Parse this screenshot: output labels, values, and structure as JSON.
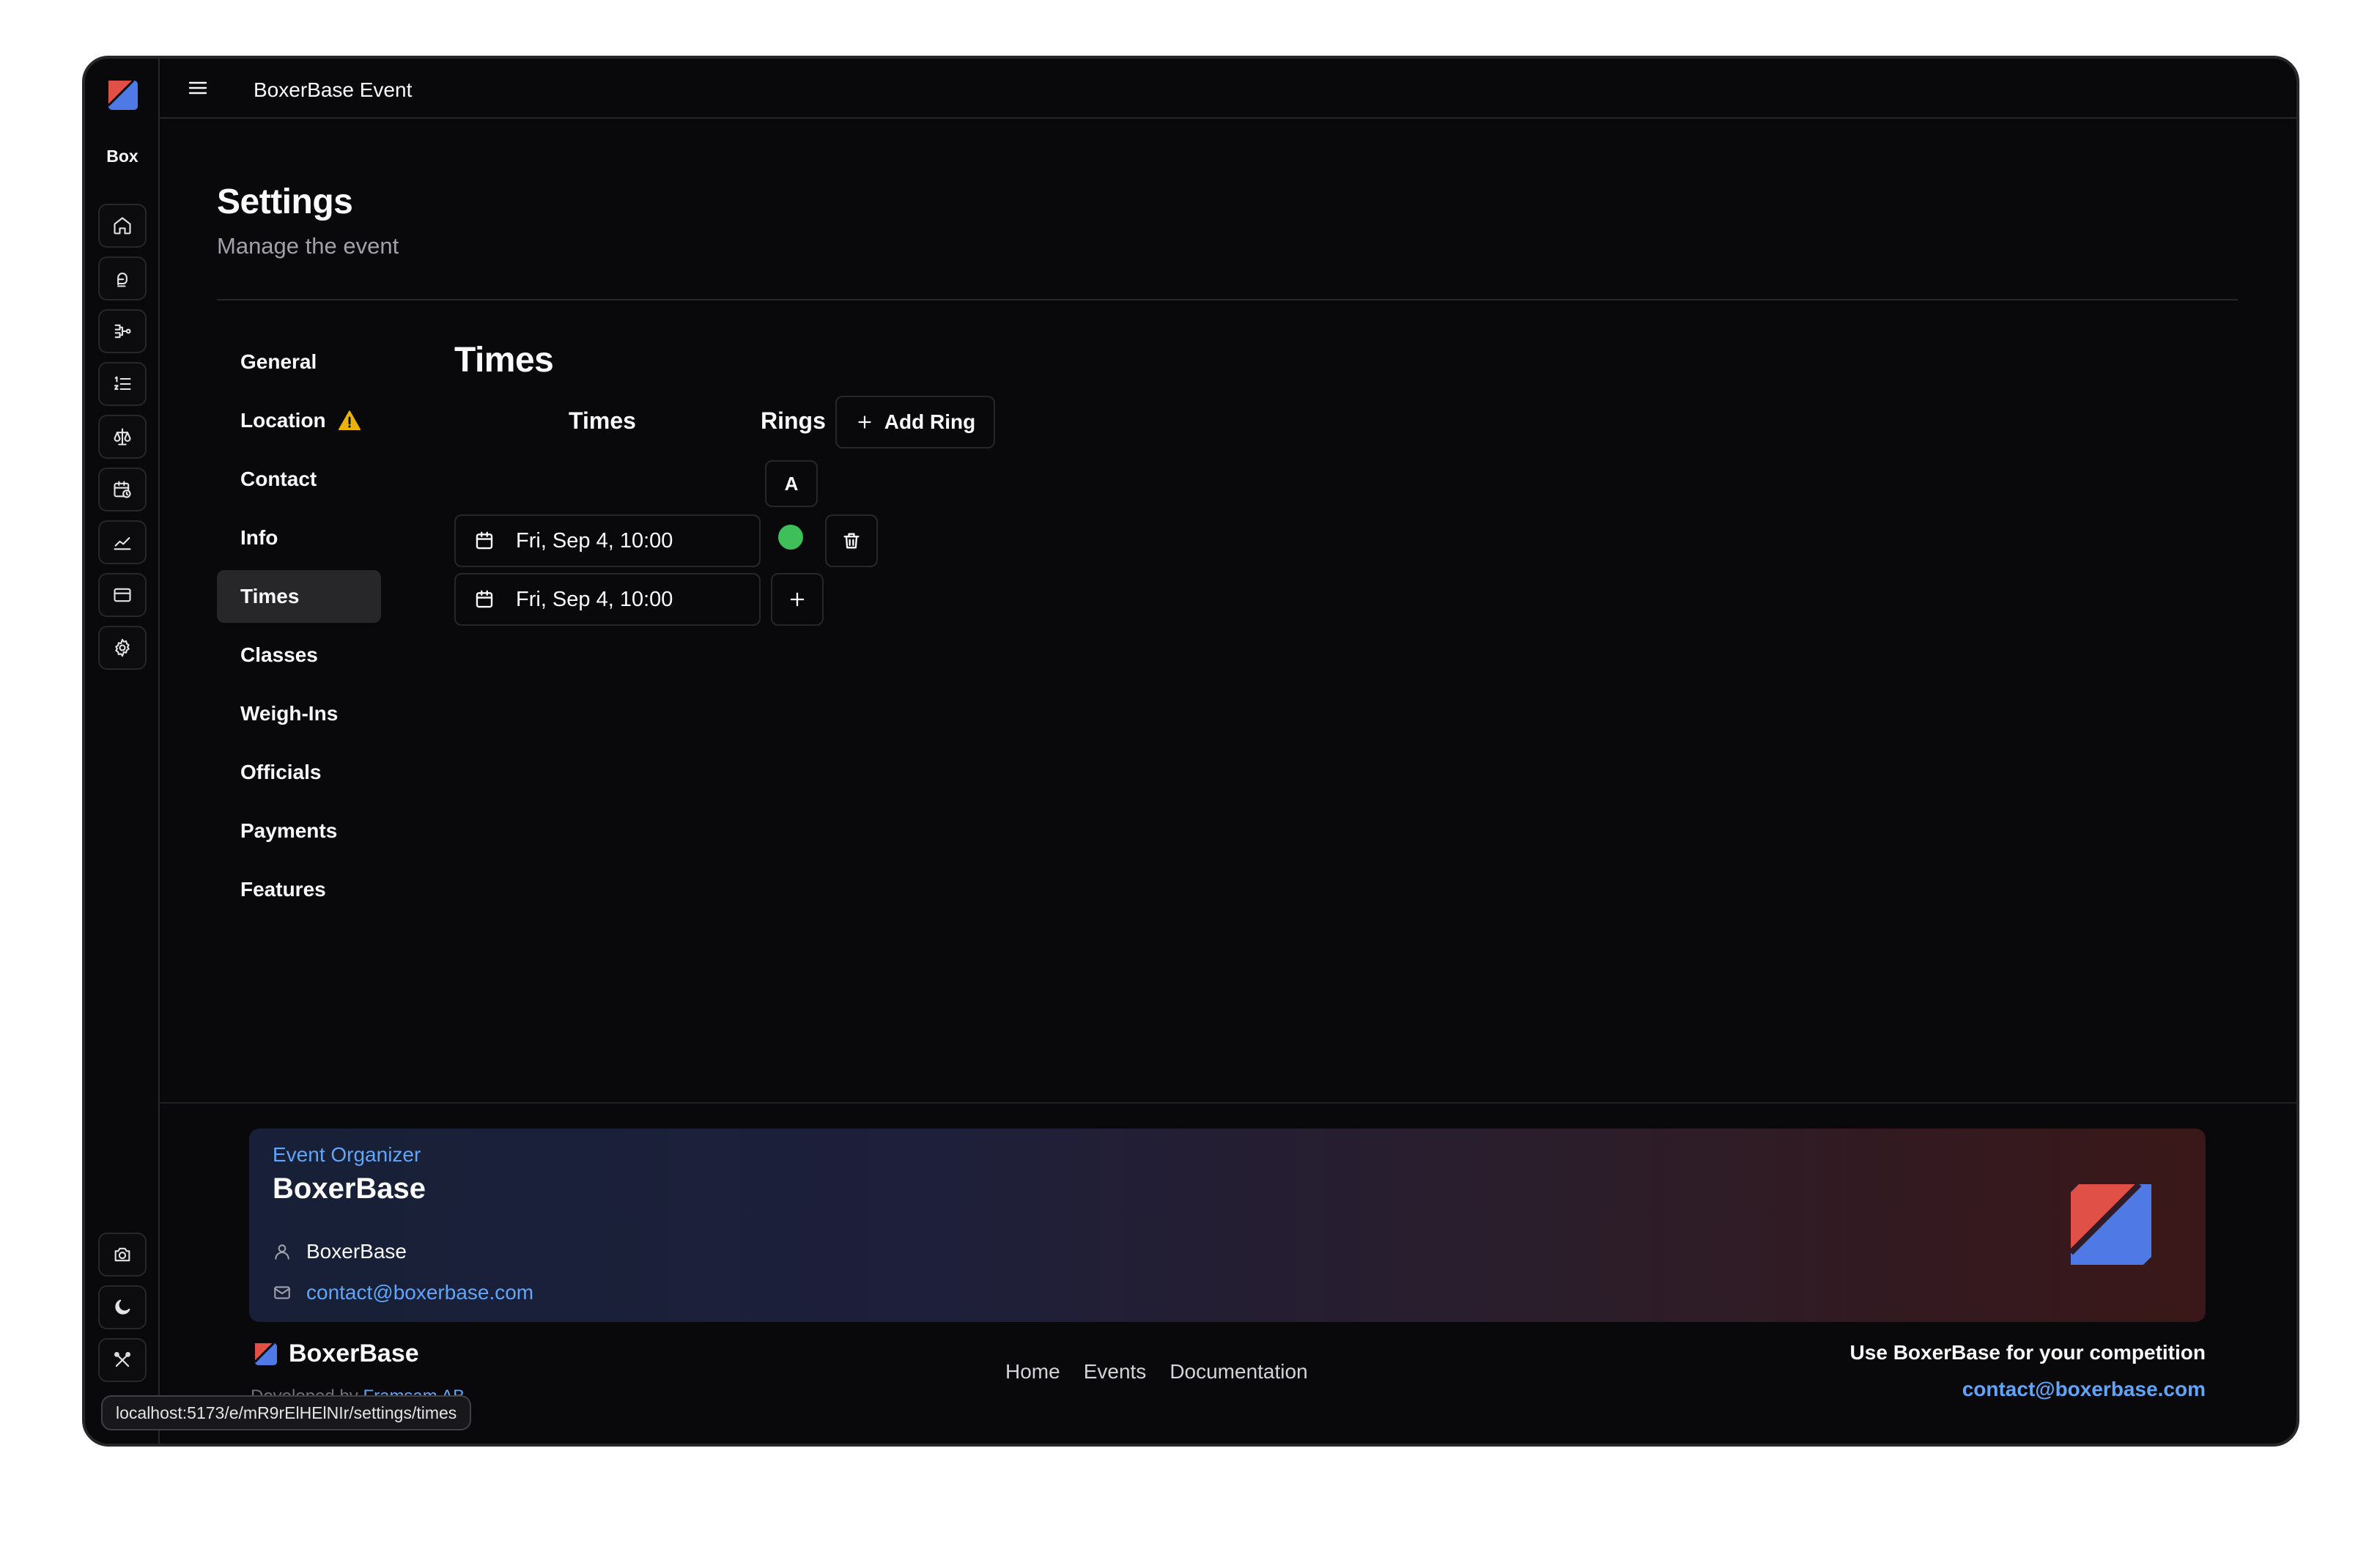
{
  "app": {
    "rail_title": "Box",
    "header_title": "BoxerBase Event"
  },
  "rail": {
    "top_icons": [
      "home-icon",
      "glove-icon",
      "bracket-icon",
      "list-icon",
      "scale-icon",
      "calendar-clock-icon",
      "chart-icon",
      "card-icon",
      "gear-icon"
    ],
    "bottom_icons": [
      "camera-icon",
      "moon-icon",
      "tools-icon"
    ]
  },
  "page": {
    "title": "Settings",
    "subtitle": "Manage the event"
  },
  "settings_nav": {
    "items": [
      {
        "label": "General"
      },
      {
        "label": "Location",
        "warning": true
      },
      {
        "label": "Contact"
      },
      {
        "label": "Info"
      },
      {
        "label": "Times",
        "active": true
      },
      {
        "label": "Classes"
      },
      {
        "label": "Weigh-Ins"
      },
      {
        "label": "Officials"
      },
      {
        "label": "Payments"
      },
      {
        "label": "Features"
      }
    ]
  },
  "times": {
    "title": "Times",
    "col_times": "Times",
    "col_rings": "Rings",
    "add_ring_label": "Add Ring",
    "ring_name": "A",
    "rows": [
      {
        "value": "Fri, Sep 4, 10:00"
      },
      {
        "value": "Fri, Sep 4, 10:00"
      }
    ],
    "ring_dot_color": "#3fbf5a"
  },
  "organizer": {
    "label": "Event Organizer",
    "name": "BoxerBase",
    "person": "BoxerBase",
    "email": "contact@boxerbase.com"
  },
  "footer": {
    "brand": "BoxerBase",
    "developed_by_prefix": "Developed by",
    "developer": "Framsam AB",
    "links": [
      "Home",
      "Events",
      "Documentation"
    ],
    "cta_text": "Use BoxerBase for your competition",
    "cta_email": "contact@boxerbase.com"
  },
  "status_url": "localhost:5173/e/mR9rElHElNIr/settings/times",
  "colors": {
    "brand_red": "#e05047",
    "brand_blue": "#4f7ae6",
    "link_blue": "#60a5fa",
    "warning": "#eab308"
  }
}
